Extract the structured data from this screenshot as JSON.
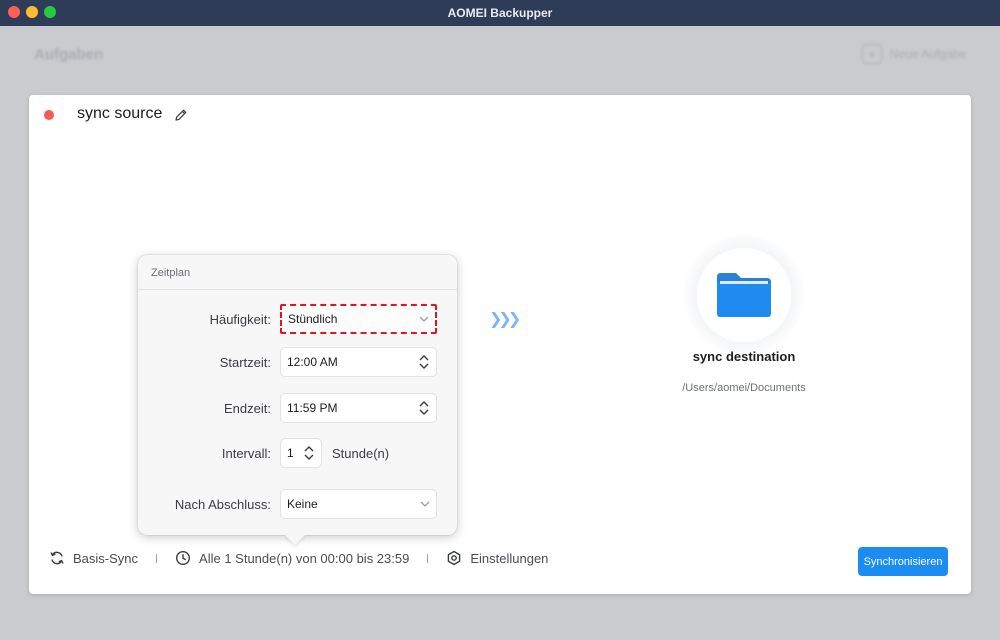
{
  "window": {
    "title": "AOMEI Backupper",
    "controls": [
      "close",
      "minimize",
      "zoom"
    ]
  },
  "background": {
    "page_title": "Aufgaben",
    "new_task_label": "Neue Aufgabe"
  },
  "task": {
    "name": "sync source",
    "status_color": "#f35a52"
  },
  "destination": {
    "name": "sync destination",
    "path": "/Users/aomei/Documents",
    "icon": "folder-icon"
  },
  "schedule_popover": {
    "title": "Zeitplan",
    "frequency_label": "Häufigkeit:",
    "frequency_value": "Stündlich",
    "start_label": "Startzeit:",
    "start_value": "12:00 AM",
    "end_label": "Endzeit:",
    "end_value": "11:59 PM",
    "interval_label": "Intervall:",
    "interval_value": "1",
    "interval_unit": "Stunde(n)",
    "after_label": "Nach Abschluss:",
    "after_value": "Keine"
  },
  "footer": {
    "sync_mode": "Basis-Sync",
    "schedule_summary": "Alle 1 Stunde(n) von 00:00 bis 23:59",
    "settings": "Einstellungen",
    "sync_button": "Synchronisieren"
  },
  "colors": {
    "accent": "#1a8cf2",
    "highlight_border": "#e0151f",
    "titlebar": "#2e3c58"
  }
}
